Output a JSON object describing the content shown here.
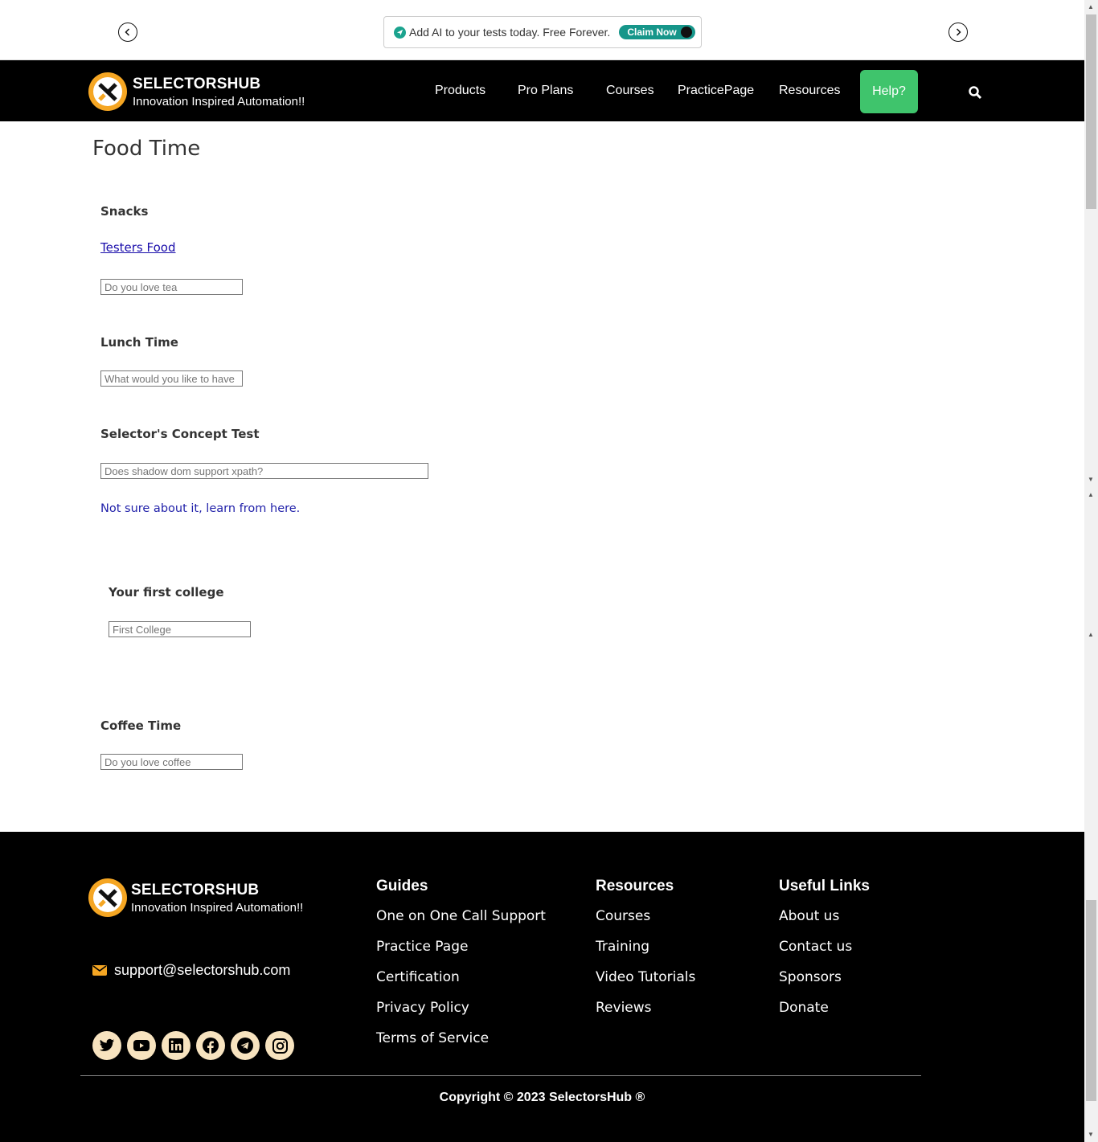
{
  "announcement": {
    "text": "Add AI to your tests today. Free Forever.",
    "claim_label": "Claim Now"
  },
  "header": {
    "brand_title": "SELECTORSHUB",
    "brand_subtitle": "Innovation Inspired Automation!!",
    "nav": [
      "Products",
      "Pro Plans",
      "Courses",
      "PracticePage",
      "Resources"
    ],
    "help_label": "Help?"
  },
  "main": {
    "page_title": "Food Time",
    "snacks": {
      "label": "Snacks",
      "link": "Testers Food",
      "placeholder": "Do you love tea"
    },
    "lunch": {
      "label": "Lunch Time",
      "placeholder": "What would you like to have"
    },
    "concept": {
      "label": "Selector's Concept Test",
      "placeholder": "Does shadow dom support xpath?",
      "link": "Not sure about it, learn from here."
    },
    "college": {
      "label": "Your first college",
      "placeholder": "First College"
    },
    "coffee": {
      "label": "Coffee Time",
      "placeholder": "Do you love coffee"
    }
  },
  "footer": {
    "brand_title": "SELECTORSHUB",
    "brand_subtitle": "Innovation Inspired Automation!!",
    "email": "support@selectorshub.com",
    "guides": {
      "title": "Guides",
      "links": [
        "One on One Call Support",
        "Practice Page",
        "Certification",
        "Privacy Policy",
        "Terms of Service"
      ]
    },
    "resources": {
      "title": "Resources",
      "links": [
        "Courses",
        "Training",
        "Video Tutorials",
        "Reviews"
      ]
    },
    "useful": {
      "title": "Useful Links",
      "links": [
        "About us",
        "Contact us",
        "Sponsors",
        "Donate"
      ]
    },
    "socials": [
      "twitter-icon",
      "youtube-icon",
      "linkedin-icon",
      "facebook-icon",
      "telegram-icon",
      "instagram-icon"
    ],
    "copyright": "Copyright © 2023 SelectorsHub ®"
  },
  "colors": {
    "accent_orange": "#f5a623",
    "help_green": "#3fc46c",
    "claim_teal": "#16968a",
    "header_bg": "#000000"
  }
}
